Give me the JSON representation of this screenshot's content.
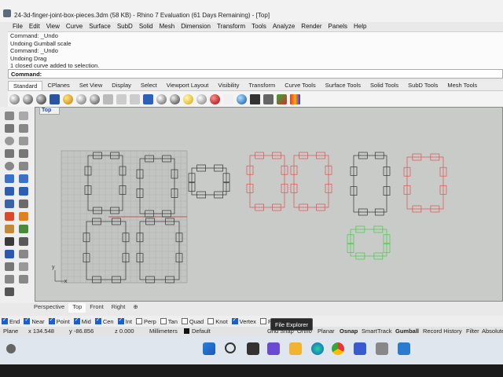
{
  "window": {
    "title": "24-3d-finger-joint-box-pieces.3dm (58 KB) - Rhino 7 Evaluation (61 Days Remaining) - [Top]"
  },
  "menu": [
    "File",
    "Edit",
    "View",
    "Curve",
    "Surface",
    "SubD",
    "Solid",
    "Mesh",
    "Dimension",
    "Transform",
    "Tools",
    "Analyze",
    "Render",
    "Panels",
    "Help"
  ],
  "command_history": [
    "Command: _Undo",
    "Undoing Gumball scale",
    "Command: _Undo",
    "Undoing Drag",
    "1 closed curve added to selection."
  ],
  "command_prompt": "Command:",
  "toolbar_tabs": [
    "Standard",
    "CPlanes",
    "Set View",
    "Display",
    "Select",
    "Viewport Layout",
    "Visibility",
    "Transform",
    "Curve Tools",
    "Surface Tools",
    "Solid Tools",
    "SubD Tools",
    "Mesh Tools"
  ],
  "viewport": {
    "label": "Top",
    "axis_y": "y",
    "axis_x": "x"
  },
  "viewport_tabs": [
    "Perspective",
    "Top",
    "Front",
    "Right",
    "⊕"
  ],
  "osnaps": [
    {
      "label": "End",
      "on": true
    },
    {
      "label": "Near",
      "on": true
    },
    {
      "label": "Point",
      "on": true
    },
    {
      "label": "Mid",
      "on": true
    },
    {
      "label": "Cen",
      "on": true
    },
    {
      "label": "Int",
      "on": true
    },
    {
      "label": "Perp",
      "on": false
    },
    {
      "label": "Tan",
      "on": false
    },
    {
      "label": "Quad",
      "on": false
    },
    {
      "label": "Knot",
      "on": false
    },
    {
      "label": "Vertex",
      "on": true
    },
    {
      "label": "Proj",
      "on": false
    }
  ],
  "status": {
    "cplane": "Plane",
    "x": "x 134.548",
    "y": "y -86.856",
    "z": "z 0.000",
    "units": "Millimeters",
    "layer": "Default",
    "buttons": [
      "Grid Snap",
      "Ortho",
      "Planar",
      "Osnap",
      "SmartTrack",
      "Gumball",
      "Record History",
      "Filter",
      "Absolute"
    ]
  },
  "tooltip": "File Explorer",
  "colors": {
    "red_curve": "#e05050",
    "green_curve": "#40cc40",
    "black_curve": "#333333",
    "grid": "#a9aba9"
  }
}
